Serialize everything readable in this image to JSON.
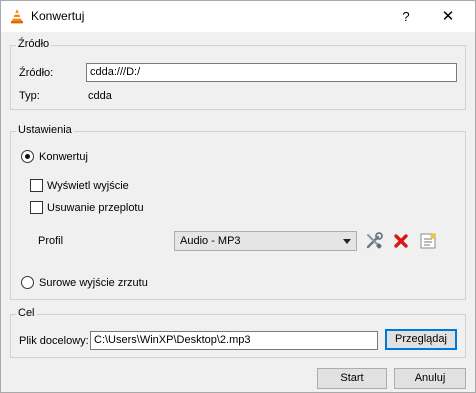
{
  "window": {
    "title": "Konwertuj",
    "help_label": "?",
    "close_label": "✕"
  },
  "source": {
    "group_title": "Źródło",
    "source_label": "Źródło:",
    "source_value": "cdda:///D:/",
    "type_label": "Typ:",
    "type_value": "cdda"
  },
  "settings": {
    "group_title": "Ustawienia",
    "convert_label": "Konwertuj",
    "convert_selected": true,
    "show_output_label": "Wyświetl wyjście",
    "show_output_checked": false,
    "deinterlace_label": "Usuwanie przeplotu",
    "deinterlace_checked": false,
    "profile_label": "Profil",
    "profile_value": "Audio - MP3",
    "raw_dump_label": "Surowe wyjście zrzutu",
    "raw_dump_selected": false
  },
  "target": {
    "group_title": "Cel",
    "dest_label": "Plik docelowy:",
    "dest_value": "C:\\Users\\WinXP\\Desktop\\2.mp3",
    "browse_label": "Przeglądaj"
  },
  "footer": {
    "start_label": "Start",
    "cancel_label": "Anuluj"
  },
  "icons": {
    "title": "vlc-cone-icon",
    "edit_profile": "wrench-screwdriver-icon",
    "delete_profile": "red-x-icon",
    "new_profile": "new-document-icon"
  }
}
